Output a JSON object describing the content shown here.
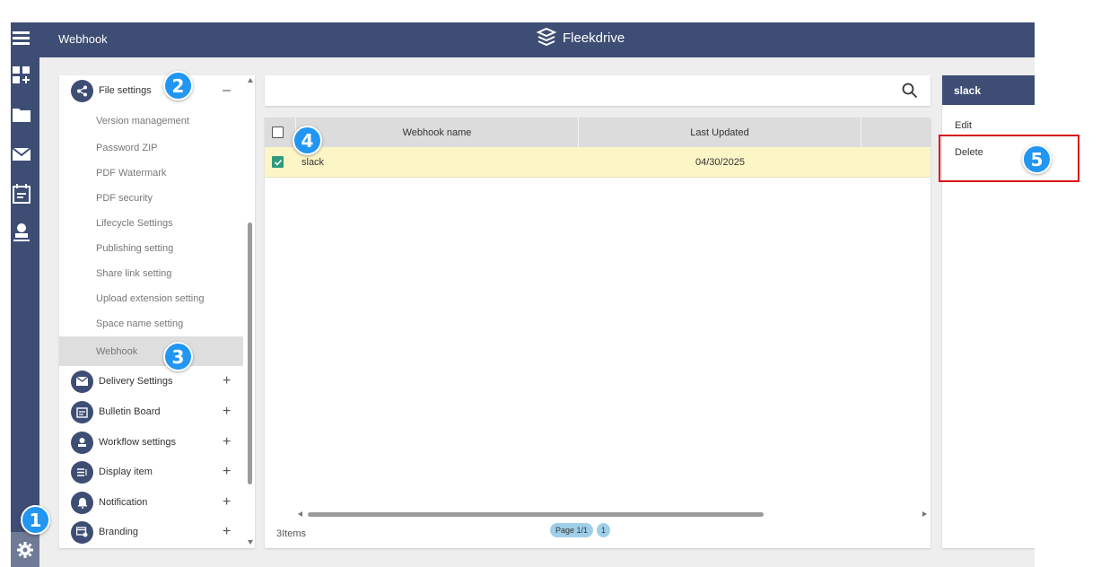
{
  "header": {
    "title": "Webhook",
    "brand": "Fleekdrive"
  },
  "rail": {
    "icons": [
      "grid-add-icon",
      "folder-icon",
      "mail-icon",
      "board-icon",
      "stamp-icon"
    ],
    "bottom_icon": "gear-icon"
  },
  "settings": {
    "file_section": {
      "label": "File settings",
      "toggle": "–"
    },
    "sub_items": [
      "Version management",
      "Password ZIP",
      "PDF Watermark",
      "PDF security",
      "Lifecycle Settings",
      "Publishing setting",
      "Share link setting",
      "Upload extension setting",
      "Space name setting",
      "Webhook"
    ],
    "sections": [
      {
        "label": "Delivery Settings",
        "toggle": "+"
      },
      {
        "label": "Bulletin Board",
        "toggle": "+"
      },
      {
        "label": "Workflow settings",
        "toggle": "+"
      },
      {
        "label": "Display item",
        "toggle": "+"
      },
      {
        "label": "Notification",
        "toggle": "+"
      },
      {
        "label": "Branding",
        "toggle": "+"
      }
    ]
  },
  "grid": {
    "columns": [
      "Webhook name",
      "Last Updated"
    ],
    "rows": [
      {
        "name": "slack",
        "updated": "04/30/2025",
        "checked": true
      }
    ],
    "footer_count": "3Items",
    "page_label": "Page 1/1",
    "page_number": "1"
  },
  "detail": {
    "title": "slack",
    "actions": [
      "Edit",
      "Delete"
    ]
  },
  "badges": [
    "1",
    "2",
    "3",
    "4",
    "5"
  ],
  "colors": {
    "navy": "#3d4d74",
    "selected_row": "#fcf6c7",
    "badge": "#2196f3",
    "highlight": "#d9121b",
    "check": "#2f9a7d"
  }
}
